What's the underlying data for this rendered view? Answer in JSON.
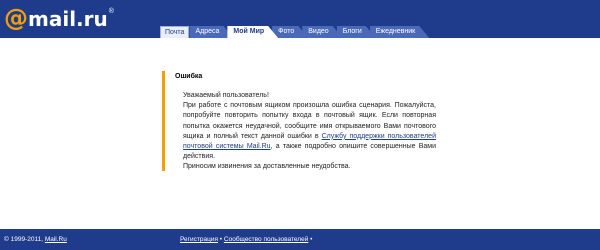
{
  "header": {
    "logo": {
      "at": "@",
      "word": "mail.ru",
      "reg": "®"
    },
    "tabs": [
      {
        "label": "Почта"
      },
      {
        "label": "Адреса"
      },
      {
        "label": "Мой Мир",
        "active": true
      },
      {
        "label": "Фото"
      },
      {
        "label": "Видео"
      },
      {
        "label": "Блоги"
      },
      {
        "label": "Ежедневник"
      }
    ]
  },
  "error": {
    "title": "Ошибка",
    "greeting": "Уважаемый пользователь!",
    "line1": "При работе с почтовым ящиком произошла ошибка сценария. Пожалуйста, попробуйте повторить попытку входа в почтовый ящик. Если повторная попытка окажется неудачной, сообщите имя открываемого Вами почтового ящика и полный текст данной ошибки в",
    "support_link": "Службу поддержки пользователей почтовой системы Mail.Ru",
    "line2": ", а также подробно опишите совершенные Вами действия.",
    "apology": "Приносим извинения за доставленные неудобства."
  },
  "footer": {
    "copyright_prefix": "© 1999-2011,",
    "copyright_link": "Mail.Ru",
    "registration": "Регистрация",
    "separator": " • ",
    "community": "Сообщество пользователей",
    "trailing": " •"
  },
  "colors": {
    "brand_blue": "#1f3c8c",
    "accent_orange": "#f5a000"
  }
}
